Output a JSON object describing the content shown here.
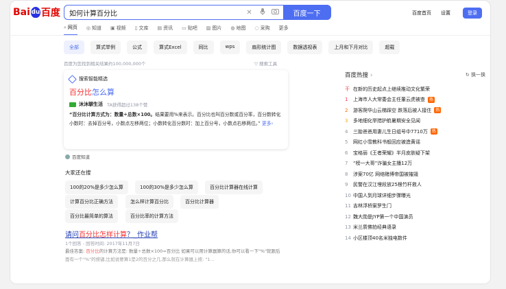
{
  "logo": {
    "text_left": "Bai",
    "paw": "du",
    "text_right": "百度"
  },
  "search": {
    "query": "如何计算百分比",
    "button": "百度一下"
  },
  "toplinks": {
    "home": "百度首页",
    "settings": "设置",
    "login": "登录"
  },
  "tabs": [
    {
      "label": "网页",
      "icon": "search-icon"
    },
    {
      "label": "知道",
      "icon": "question-icon"
    },
    {
      "label": "视频",
      "icon": "video-icon"
    },
    {
      "label": "文库",
      "icon": "document-icon"
    },
    {
      "label": "资讯",
      "icon": "news-icon"
    },
    {
      "label": "贴吧",
      "icon": "forum-icon"
    },
    {
      "label": "图片",
      "icon": "image-icon"
    },
    {
      "label": "地图",
      "icon": "map-icon"
    },
    {
      "label": "采购",
      "icon": "cart-icon"
    },
    {
      "label": "更多",
      "icon": ""
    }
  ],
  "chips": [
    "全部",
    "算式举例",
    "公式",
    "算式Excel",
    "同比",
    "wps",
    "扇形统计图",
    "数据透视表",
    "上月和下月对比",
    "超载"
  ],
  "result_count": "百度为您找到相关结果约100,000,000个",
  "search_tools": "搜索工具",
  "smart": {
    "badge": "搜索智能精选",
    "title_red": "百分比",
    "title_blue": "怎么算",
    "author": "沐沐聊生活",
    "author_sub": "TA获得超过138个赞",
    "body_bold": "“百分比计算方式为：数量÷总数×100。",
    "body_text": "结果要用%来表示。百分比也叫百分数或百分率，百分数转化小数时：去掉百分号，小数点左移两位；小数转化百分数时：加上百分号，小数点右移两位。”",
    "more": "更多"
  },
  "source": "百度知道",
  "also": {
    "heading": "大家还在搜",
    "items": [
      "100的20%是多少怎么算",
      "100的30%是多少怎么算",
      "百分比计算器在线计算",
      "计算百分比正确方法",
      "怎么样计算百分比",
      "百分比计算器",
      "百分比最简单的算法",
      "百分比率的计算方法"
    ]
  },
  "result2": {
    "title_pre": "请问",
    "title_em": "百分比怎样计算",
    "title_post": "？_作业帮",
    "meta": "1个回答 - 回答时间: 2017年11月7日",
    "text_pre": "最佳答案: ",
    "text_em": "百分比",
    "text_rest": "的计算方法是: 数量÷总数×100=百分比 如果可以用计算器算的话,你可以看一下\"%\"就跟后面有一个\"%\"的按键,比如说要算1是2的百分之几,那么就在计算器上按: \"1..."
  },
  "hot": {
    "heading": "百度热搜",
    "refresh": "换一换",
    "items": [
      {
        "rank": "干",
        "text": "在新的历史起点上继续推动文化繁荣",
        "tag": ""
      },
      {
        "rank": "1",
        "text": "上海市人大常委会主任董云虎被查",
        "tag": "热"
      },
      {
        "rank": "2",
        "text": "游客爬华山云梯踩空 跌落后被人接住",
        "tag": "热"
      },
      {
        "rank": "3",
        "text": "多地细化举措护航暑期安全见闻",
        "tag": ""
      },
      {
        "rank": "4",
        "text": "三胎爸爸用妻儿生日组号中7710万",
        "tag": "热"
      },
      {
        "rank": "5",
        "text": "网红小雪教科书般回应被造黄谣",
        "tag": ""
      },
      {
        "rank": "6",
        "text": "宝格丽《王者荣耀》半月皮肤疑下架",
        "tag": ""
      },
      {
        "rank": "7",
        "text": "“榜一大哥”诈骗女主播12万",
        "tag": ""
      },
      {
        "rank": "8",
        "text": "涉案70亿 网络赌博帝国被摧毁",
        "tag": ""
      },
      {
        "rank": "9",
        "text": "民警在汉江埋段放25根竹杆救人",
        "tag": ""
      },
      {
        "rank": "10",
        "text": "中国人到月球详细步骤曝光",
        "tag": ""
      },
      {
        "rank": "11",
        "text": "吉林浮桥案罗生门",
        "tag": ""
      },
      {
        "rank": "12",
        "text": "魏大勋是JYP第一个中国演员",
        "tag": ""
      },
      {
        "rank": "13",
        "text": "米兰质佛拍经典语录",
        "tag": ""
      },
      {
        "rank": "14",
        "text": "小区楼顶40名米独电数件",
        "tag": ""
      }
    ]
  },
  "colors": {
    "accent": "#4e6ef2",
    "brand_red": "#e10602",
    "hot_red": "#f73131",
    "link": "#2440b3"
  }
}
